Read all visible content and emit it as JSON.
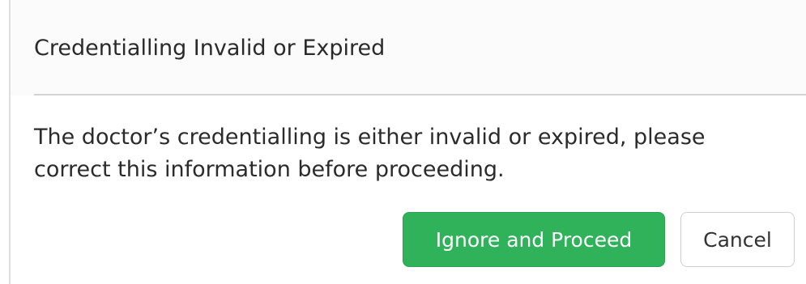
{
  "dialog": {
    "title": "Credentialling Invalid or Expired",
    "message": "The doctor’s credentialling is either invalid or expired, please correct this information before proceeding.",
    "buttons": {
      "primary_label": "Ignore and Proceed",
      "secondary_label": "Cancel"
    }
  },
  "colors": {
    "primary_button": "#2fb25a",
    "header_background": "#fbfbfb",
    "divider": "#d3d3d3"
  }
}
